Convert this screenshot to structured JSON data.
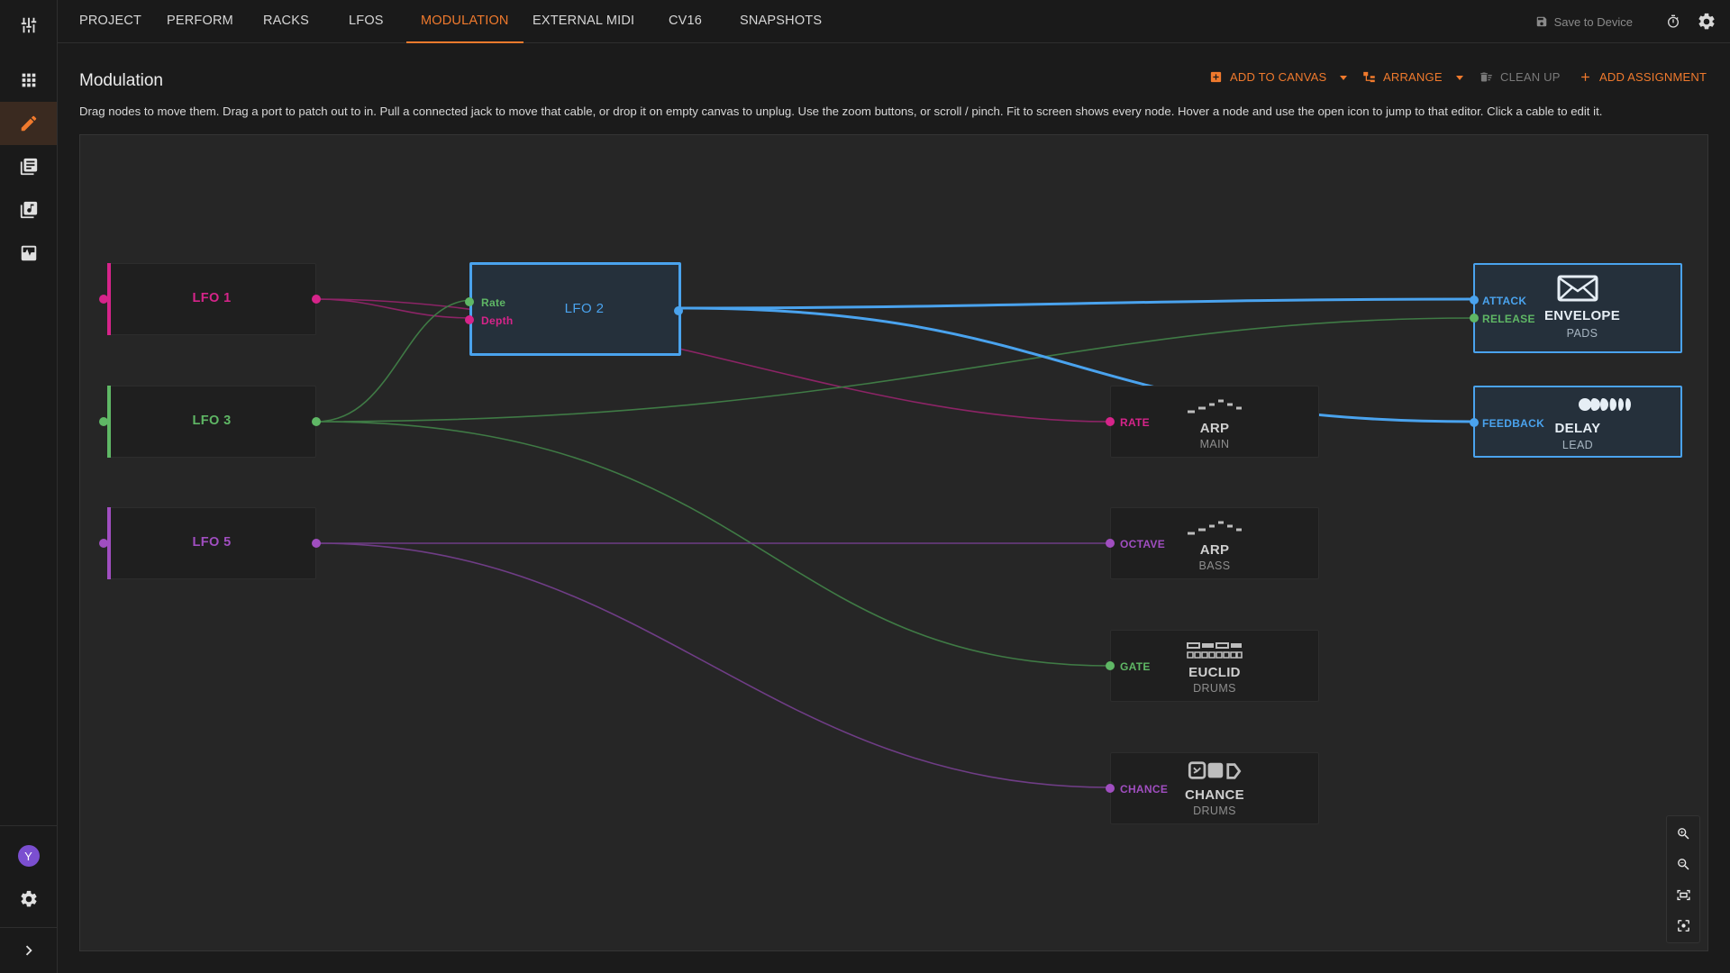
{
  "app": {
    "tabs": [
      "PROJECT",
      "PERFORM",
      "RACKS",
      "LFOS",
      "MODULATION",
      "EXTERNAL MIDI",
      "CV16",
      "SNAPSHOTS"
    ],
    "active_tab": "MODULATION",
    "save_label": "Save to Device",
    "avatar_initial": "Y"
  },
  "page": {
    "title": "Modulation",
    "hint": "Drag nodes to move them. Drag a port to patch out to in. Pull a connected jack to move that cable, or drop it on empty canvas to unplug. Use the zoom buttons, or scroll / pinch. Fit to screen shows every node. Hover a node and use the open icon to jump to that editor. Click a cable to edit it.",
    "actions": {
      "add_to_canvas": "ADD TO CANVAS",
      "arrange": "ARRANGE",
      "clean_up": "CLEAN UP",
      "add_assignment": "ADD ASSIGNMENT"
    }
  },
  "colors": {
    "accent": "#f07a2d",
    "lfo1": "#d6248a",
    "lfo3": "#5fb765",
    "lfo5": "#a04ec0",
    "lfo2": "#4aa3ee"
  },
  "sources": [
    {
      "id": "lfo1",
      "label": "LFO 1",
      "color": "#d6248a"
    },
    {
      "id": "lfo2",
      "label": "LFO 2",
      "color": "#4aa3ee",
      "inputs": [
        {
          "label": "Rate",
          "color": "#5fb765"
        },
        {
          "label": "Depth",
          "color": "#d6248a"
        }
      ]
    },
    {
      "id": "lfo3",
      "label": "LFO 3",
      "color": "#5fb765"
    },
    {
      "id": "lfo5",
      "label": "LFO 5",
      "color": "#a04ec0"
    }
  ],
  "destinations": [
    {
      "id": "envelope",
      "title": "ENVELOPE",
      "sub": "PADS",
      "icon": "envelope-icon",
      "ports": [
        {
          "label": "ATTACK",
          "color": "#4aa3ee"
        },
        {
          "label": "RELEASE",
          "color": "#5fb765"
        }
      ]
    },
    {
      "id": "delay",
      "title": "DELAY",
      "sub": "LEAD",
      "icon": "delay-icon",
      "ports": [
        {
          "label": "FEEDBACK",
          "color": "#4aa3ee"
        }
      ]
    },
    {
      "id": "arp_main",
      "title": "ARP",
      "sub": "MAIN",
      "icon": "arp-icon",
      "ports": [
        {
          "label": "RATE",
          "color": "#d6248a"
        }
      ]
    },
    {
      "id": "arp_bass",
      "title": "ARP",
      "sub": "BASS",
      "icon": "arp-icon",
      "ports": [
        {
          "label": "OCTAVE",
          "color": "#a04ec0"
        }
      ]
    },
    {
      "id": "euclid",
      "title": "EUCLID",
      "sub": "DRUMS",
      "icon": "euclid-icon",
      "ports": [
        {
          "label": "GATE",
          "color": "#5fb765"
        }
      ]
    },
    {
      "id": "chance",
      "title": "CHANCE",
      "sub": "DRUMS",
      "icon": "chance-icon",
      "ports": [
        {
          "label": "CHANCE",
          "color": "#a04ec0"
        }
      ]
    }
  ]
}
